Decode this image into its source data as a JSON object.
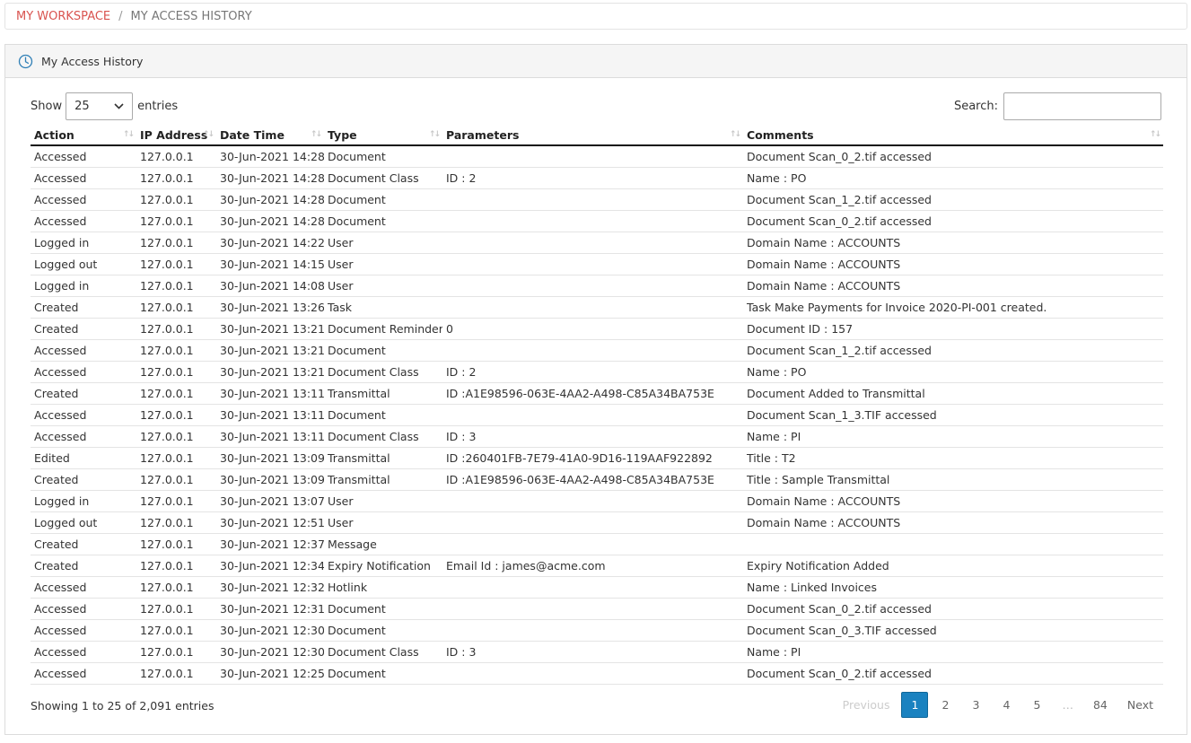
{
  "breadcrumb": {
    "root": "MY WORKSPACE",
    "separator": "/",
    "current": "MY ACCESS HISTORY"
  },
  "panel": {
    "title": "My Access History",
    "icon": "clock-icon"
  },
  "controls": {
    "show_label": "Show",
    "entries_value": "25",
    "entries_label": "entries",
    "search_label": "Search:",
    "search_value": ""
  },
  "table": {
    "columns": [
      "Action",
      "IP Address",
      "Date Time",
      "Type",
      "Parameters",
      "Comments"
    ],
    "rows": [
      [
        "Accessed",
        "127.0.0.1",
        "30-Jun-2021 14:28",
        "Document",
        "",
        "Document Scan_0_2.tif accessed"
      ],
      [
        "Accessed",
        "127.0.0.1",
        "30-Jun-2021 14:28",
        "Document Class",
        "ID : 2",
        "Name : PO"
      ],
      [
        "Accessed",
        "127.0.0.1",
        "30-Jun-2021 14:28",
        "Document",
        "",
        "Document Scan_1_2.tif accessed"
      ],
      [
        "Accessed",
        "127.0.0.1",
        "30-Jun-2021 14:28",
        "Document",
        "",
        "Document Scan_0_2.tif accessed"
      ],
      [
        "Logged in",
        "127.0.0.1",
        "30-Jun-2021 14:22",
        "User",
        "",
        "Domain Name : ACCOUNTS"
      ],
      [
        "Logged out",
        "127.0.0.1",
        "30-Jun-2021 14:15",
        "User",
        "",
        "Domain Name : ACCOUNTS"
      ],
      [
        "Logged in",
        "127.0.0.1",
        "30-Jun-2021 14:08",
        "User",
        "",
        "Domain Name : ACCOUNTS"
      ],
      [
        "Created",
        "127.0.0.1",
        "30-Jun-2021 13:26",
        "Task",
        "",
        "Task Make Payments for Invoice 2020-PI-001 created."
      ],
      [
        "Created",
        "127.0.0.1",
        "30-Jun-2021 13:21",
        "Document Reminder",
        "0",
        "Document ID : 157"
      ],
      [
        "Accessed",
        "127.0.0.1",
        "30-Jun-2021 13:21",
        "Document",
        "",
        "Document Scan_1_2.tif accessed"
      ],
      [
        "Accessed",
        "127.0.0.1",
        "30-Jun-2021 13:21",
        "Document Class",
        "ID : 2",
        "Name : PO"
      ],
      [
        "Created",
        "127.0.0.1",
        "30-Jun-2021 13:11",
        "Transmittal",
        "ID :A1E98596-063E-4AA2-A498-C85A34BA753E",
        "Document Added to Transmittal"
      ],
      [
        "Accessed",
        "127.0.0.1",
        "30-Jun-2021 13:11",
        "Document",
        "",
        "Document Scan_1_3.TIF accessed"
      ],
      [
        "Accessed",
        "127.0.0.1",
        "30-Jun-2021 13:11",
        "Document Class",
        "ID : 3",
        "Name : PI"
      ],
      [
        "Edited",
        "127.0.0.1",
        "30-Jun-2021 13:09",
        "Transmittal",
        "ID :260401FB-7E79-41A0-9D16-119AAF922892",
        "Title : T2"
      ],
      [
        "Created",
        "127.0.0.1",
        "30-Jun-2021 13:09",
        "Transmittal",
        "ID :A1E98596-063E-4AA2-A498-C85A34BA753E",
        "Title : Sample Transmittal"
      ],
      [
        "Logged in",
        "127.0.0.1",
        "30-Jun-2021 13:07",
        "User",
        "",
        "Domain Name : ACCOUNTS"
      ],
      [
        "Logged out",
        "127.0.0.1",
        "30-Jun-2021 12:51",
        "User",
        "",
        "Domain Name : ACCOUNTS"
      ],
      [
        "Created",
        "127.0.0.1",
        "30-Jun-2021 12:37",
        "Message",
        "",
        ""
      ],
      [
        "Created",
        "127.0.0.1",
        "30-Jun-2021 12:34",
        "Expiry Notification",
        "Email Id : james@acme.com",
        "Expiry Notification Added"
      ],
      [
        "Accessed",
        "127.0.0.1",
        "30-Jun-2021 12:32",
        "Hotlink",
        "",
        "Name : Linked Invoices"
      ],
      [
        "Accessed",
        "127.0.0.1",
        "30-Jun-2021 12:31",
        "Document",
        "",
        "Document Scan_0_2.tif accessed"
      ],
      [
        "Accessed",
        "127.0.0.1",
        "30-Jun-2021 12:30",
        "Document",
        "",
        "Document Scan_0_3.TIF accessed"
      ],
      [
        "Accessed",
        "127.0.0.1",
        "30-Jun-2021 12:30",
        "Document Class",
        "ID : 3",
        "Name : PI"
      ],
      [
        "Accessed",
        "127.0.0.1",
        "30-Jun-2021 12:25",
        "Document",
        "",
        "Document Scan_0_2.tif accessed"
      ]
    ]
  },
  "footer": {
    "info": "Showing 1 to 25 of 2,091 entries",
    "pagination": {
      "previous": "Previous",
      "pages": [
        "1",
        "2",
        "3",
        "4",
        "5"
      ],
      "ellipsis": "…",
      "last": "84",
      "next": "Next",
      "active": "1"
    }
  },
  "colors": {
    "breadcrumb_link": "#d9534f",
    "active_page": "#1a82c0",
    "header_border": "#111111"
  }
}
